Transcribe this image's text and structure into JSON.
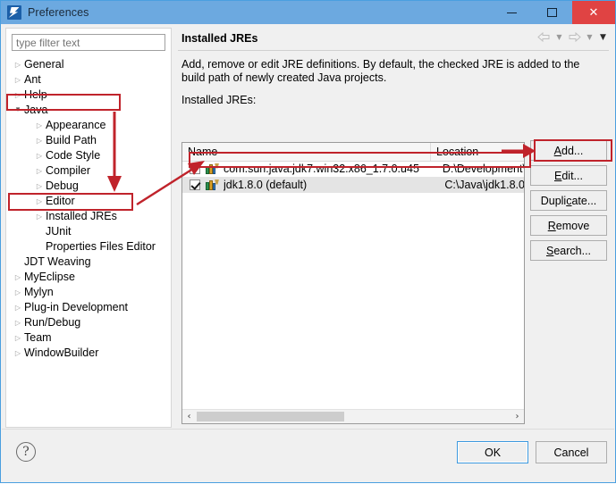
{
  "window": {
    "title": "Preferences",
    "icon": "eclipse-icon",
    "controls": {
      "minimize": "–",
      "maximize": "□",
      "close": "✕"
    }
  },
  "sidebar": {
    "filter": {
      "placeholder": "type filter text",
      "value": ""
    },
    "items": [
      {
        "label": "General",
        "level": 1,
        "state": "collapsed"
      },
      {
        "label": "Ant",
        "level": 1,
        "state": "collapsed"
      },
      {
        "label": "Help",
        "level": 1,
        "state": "collapsed"
      },
      {
        "label": "Java",
        "level": 1,
        "state": "expanded",
        "highlighted": true
      },
      {
        "label": "Appearance",
        "level": 2,
        "state": "collapsed"
      },
      {
        "label": "Build Path",
        "level": 2,
        "state": "collapsed"
      },
      {
        "label": "Code Style",
        "level": 2,
        "state": "collapsed"
      },
      {
        "label": "Compiler",
        "level": 2,
        "state": "collapsed"
      },
      {
        "label": "Debug",
        "level": 2,
        "state": "collapsed"
      },
      {
        "label": "Editor",
        "level": 2,
        "state": "collapsed"
      },
      {
        "label": "Installed JREs",
        "level": 2,
        "state": "collapsed",
        "highlighted": true
      },
      {
        "label": "JUnit",
        "level": 2,
        "state": "leaf"
      },
      {
        "label": "Properties Files Editor",
        "level": 2,
        "state": "leaf"
      },
      {
        "label": "JDT Weaving",
        "level": 1,
        "state": "leaf"
      },
      {
        "label": "MyEclipse",
        "level": 1,
        "state": "collapsed"
      },
      {
        "label": "Mylyn",
        "level": 1,
        "state": "collapsed"
      },
      {
        "label": "Plug-in Development",
        "level": 1,
        "state": "collapsed"
      },
      {
        "label": "Run/Debug",
        "level": 1,
        "state": "collapsed"
      },
      {
        "label": "Team",
        "level": 1,
        "state": "collapsed"
      },
      {
        "label": "WindowBuilder",
        "level": 1,
        "state": "collapsed"
      }
    ]
  },
  "page": {
    "title": "Installed JREs",
    "description": "Add, remove or edit JRE definitions. By default, the checked JRE is added to the build path of newly created Java projects.",
    "list_label": "Installed JREs:",
    "nav": {
      "back": "⇦",
      "back_menu": "▼",
      "forward": "⇨",
      "forward_menu": "▼",
      "view_menu": "▼"
    }
  },
  "table": {
    "columns": [
      "Name",
      "Location"
    ],
    "rows": [
      {
        "checked": false,
        "selected": false,
        "name": "com.sun.java.jdk7.win32.x86_1.7.0.u45",
        "location": "D:\\Development\\"
      },
      {
        "checked": true,
        "selected": true,
        "name": "jdk1.8.0 (default)",
        "location": "C:\\Java\\jdk1.8.0"
      }
    ],
    "scroll_left": "‹",
    "scroll_right": "›"
  },
  "side_buttons": [
    {
      "label": "Add...",
      "mnemonic_index": 0,
      "highlighted": false
    },
    {
      "label": "Edit...",
      "mnemonic_index": 0,
      "highlighted": true
    },
    {
      "label": "Duplicate...",
      "mnemonic_index": 5,
      "highlighted": false
    },
    {
      "label": "Remove",
      "mnemonic_index": 0,
      "highlighted": false
    },
    {
      "label": "Search...",
      "mnemonic_index": 0,
      "highlighted": false
    }
  ],
  "footer": {
    "help": "?",
    "ok": "OK",
    "cancel": "Cancel"
  },
  "annotation_color": "#c0232b"
}
